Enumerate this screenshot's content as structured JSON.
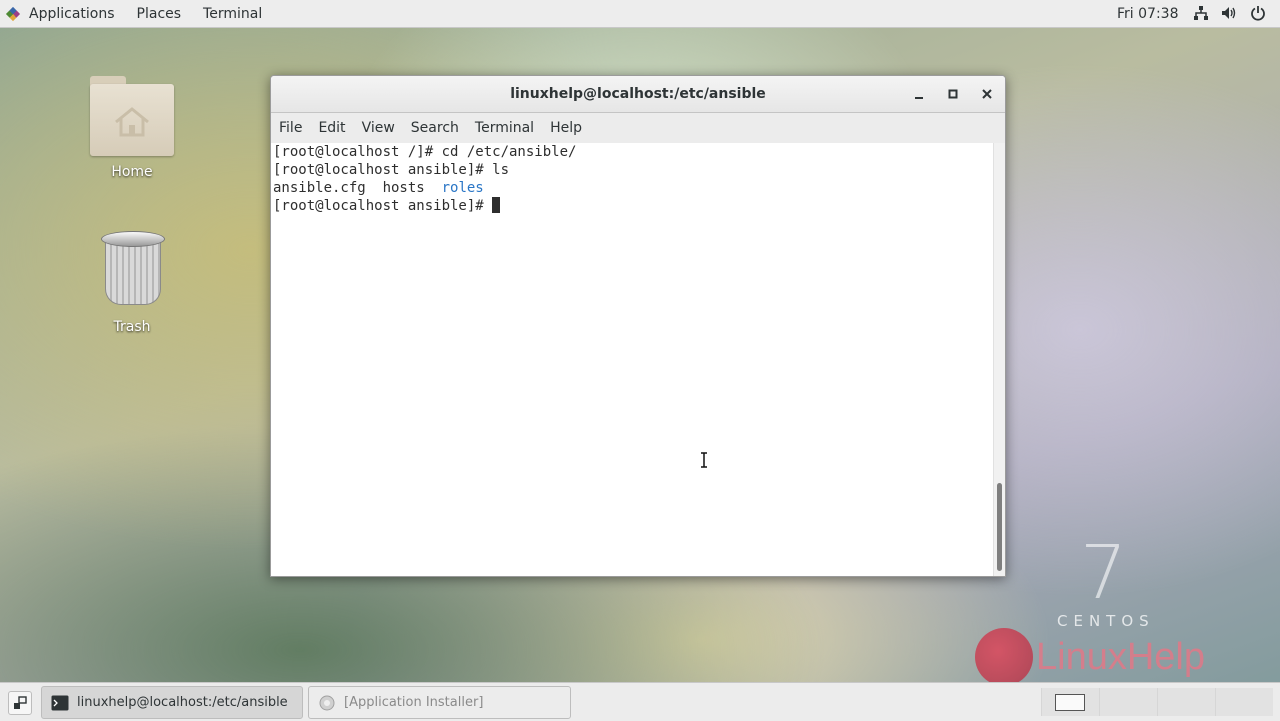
{
  "top_bar": {
    "applications": "Applications",
    "places": "Places",
    "terminal": "Terminal",
    "clock": "Fri 07:38",
    "tray_icons": [
      "network-icon",
      "volume-icon",
      "power-icon"
    ]
  },
  "desktop": {
    "icons": [
      {
        "label": "Home",
        "icon": "home-folder-icon"
      },
      {
        "label": "Trash",
        "icon": "trash-icon"
      }
    ]
  },
  "terminal_window": {
    "title": "linuxhelp@localhost:/etc/ansible",
    "menu": [
      "File",
      "Edit",
      "View",
      "Search",
      "Terminal",
      "Help"
    ],
    "lines": [
      {
        "prompt": "[root@localhost /]# ",
        "text": "cd /etc/ansible/"
      },
      {
        "prompt": "[root@localhost ansible]# ",
        "text": "ls"
      },
      {
        "files": [
          "ansible.cfg",
          "hosts"
        ],
        "dirs": [
          "roles"
        ]
      },
      {
        "prompt": "[root@localhost ansible]# ",
        "text": ""
      }
    ]
  },
  "taskbar": {
    "tasks": [
      {
        "label": "linuxhelp@localhost:/etc/ansible",
        "active": true
      },
      {
        "label": "[Application Installer]",
        "active": false
      }
    ],
    "workspaces": 4
  },
  "watermark": {
    "centos_number": "7",
    "centos_word": "CENTOS",
    "brand": "LinuxHelp"
  },
  "colors": {
    "directory": "#2a76c6",
    "panel": "#ededed"
  }
}
